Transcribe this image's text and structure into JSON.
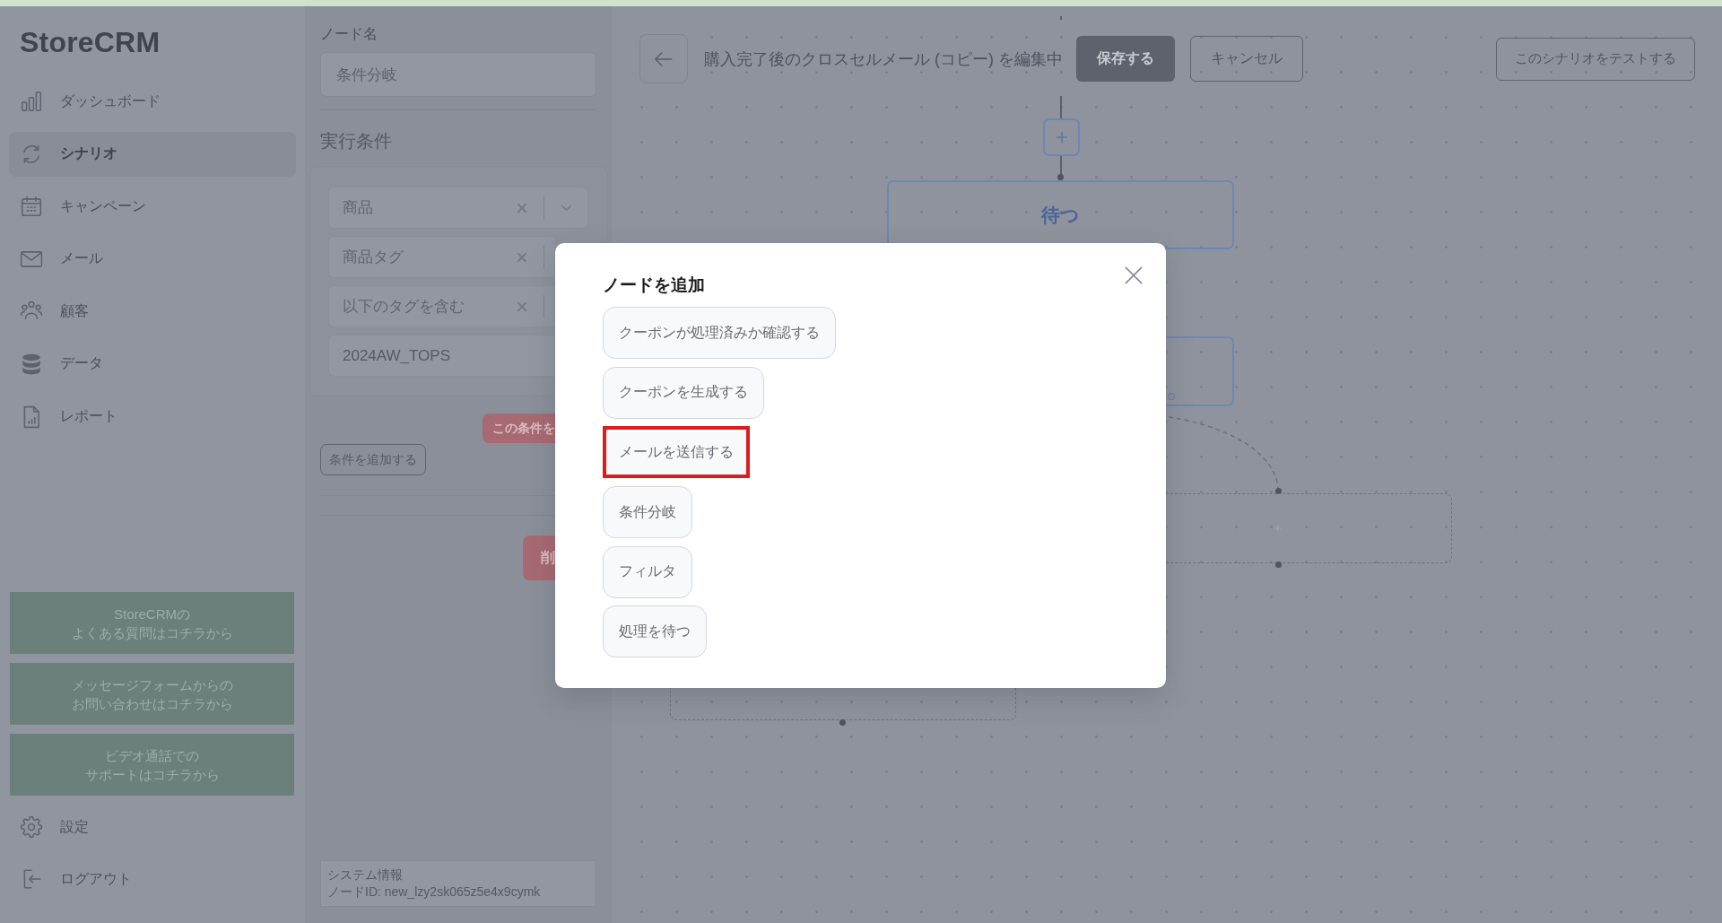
{
  "sidebar": {
    "logo": "StoreCRM",
    "nav": [
      {
        "label": "ダッシュボード",
        "selected": false
      },
      {
        "label": "シナリオ",
        "selected": true
      },
      {
        "label": "キャンペーン",
        "selected": false
      },
      {
        "label": "メール",
        "selected": false
      },
      {
        "label": "顧客",
        "selected": false
      },
      {
        "label": "データ",
        "selected": false
      },
      {
        "label": "レポート",
        "selected": false
      }
    ],
    "help_links": [
      {
        "lines": [
          "StoreCRMの",
          "よくある質問はコチラから"
        ]
      },
      {
        "lines": [
          "メッセージフォームからの",
          "お問い合わせはコチラから"
        ]
      },
      {
        "lines": [
          "ビデオ通話での",
          "サポートはコチラから"
        ]
      }
    ],
    "footer_nav": [
      {
        "label": "設定",
        "selected": false
      },
      {
        "label": "ログアウト",
        "selected": false
      }
    ]
  },
  "node_panel": {
    "name_label": "ノード名",
    "name_value": "条件分岐",
    "conditions_heading": "実行条件",
    "conditions": [
      {
        "kind": "select",
        "value": "商品"
      },
      {
        "kind": "select",
        "value": "商品タグ"
      },
      {
        "kind": "select",
        "value": "以下のタグを含む"
      },
      {
        "kind": "text",
        "value": "2024AW_TOPS"
      }
    ],
    "remove_condition_button": "この条件を",
    "add_condition_button": "条件を追加する",
    "delete_button": "削",
    "system_info": {
      "title": "システム情報",
      "node_id": "ノードID: new_lzy2sk065z5e4x9cymk"
    }
  },
  "editor": {
    "title": "購入完了後のクロスセルメール (コピー) を編集中",
    "save_button": "保存する",
    "cancel_button": "キャンセル",
    "test_button": "このシナリオをテストする",
    "nodes": [
      {
        "label": "待つ"
      }
    ]
  },
  "modal": {
    "title": "ノードを追加",
    "options": [
      {
        "label": "クーポンが処理済みか確認する",
        "highlighted": false
      },
      {
        "label": "クーポンを生成する",
        "highlighted": false
      },
      {
        "label": "メールを送信する",
        "highlighted": true
      },
      {
        "label": "条件分岐",
        "highlighted": false
      },
      {
        "label": "フィルタ",
        "highlighted": false
      },
      {
        "label": "処理を待つ",
        "highlighted": false
      }
    ]
  }
}
